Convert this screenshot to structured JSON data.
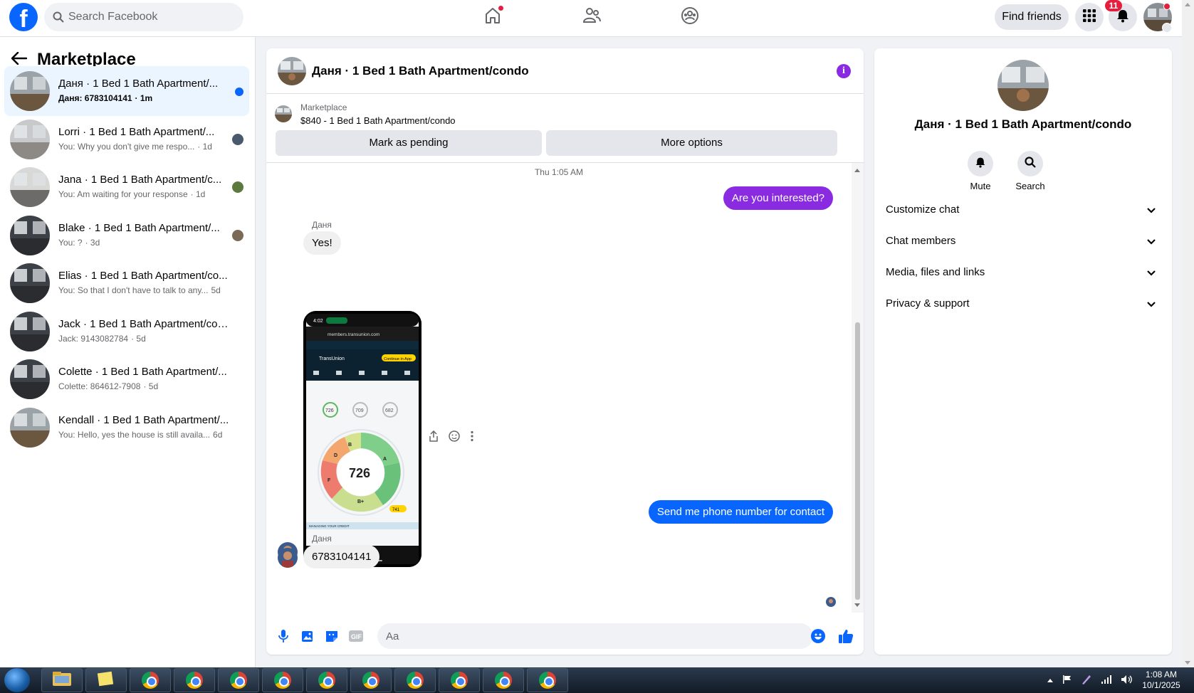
{
  "topbar": {
    "logo": "f",
    "search_placeholder": "Search Facebook",
    "find_friends": "Find friends",
    "notifications_count": "11"
  },
  "marketplace": {
    "title": "Marketplace",
    "conversations": [
      {
        "name": "Даня · 1 Bed 1 Bath Apartment/...",
        "snippet": "Даня: 6783104141",
        "time": "· 1m",
        "active": true,
        "unread": true
      },
      {
        "name": "Lorri · 1 Bed 1 Bath Apartment/...",
        "snippet": "You: Why you don't give me respo...",
        "time": "· 1d"
      },
      {
        "name": "Jana · 1 Bed 1 Bath Apartment/c...",
        "snippet": "You: Am waiting for your response",
        "time": "· 1d"
      },
      {
        "name": "Blake · 1 Bed 1 Bath Apartment/...",
        "snippet": "You: ?",
        "time": "· 3d"
      },
      {
        "name": "Elias · 1 Bed 1 Bath Apartment/co...",
        "snippet": "You: So that I don't have to talk to any...",
        "time": "5d"
      },
      {
        "name": "Jack · 1 Bed 1 Bath Apartment/con...",
        "snippet": "Jack: 9143082784",
        "time": "· 5d"
      },
      {
        "name": "Colette · 1 Bed 1 Bath Apartment/...",
        "snippet": "Colette: 864612-7908",
        "time": "· 5d"
      },
      {
        "name": "Kendall · 1 Bed 1 Bath Apartment/...",
        "snippet": "You: Hello, yes the house is still availa...",
        "time": "6d"
      }
    ]
  },
  "chat": {
    "title": "Даня · 1 Bed 1 Bath Apartment/condo",
    "listing_label": "Marketplace",
    "listing_price": "$840 - 1 Bed 1 Bath Apartment/condo",
    "mark_pending": "Mark as pending",
    "more_options": "More options",
    "timestamp": "Thu 1:05 AM",
    "messages": {
      "out1": "Are you interested?",
      "sender1": "Даня",
      "in1": "Yes!",
      "out2": "Send me phone number for contact",
      "sender2": "Даня",
      "in2": "6783104141"
    },
    "screenshot": {
      "time": "4:02",
      "url": "members.transunion.com",
      "brand": "TransUnion",
      "cta": "Continue in App",
      "score_main": "726",
      "scores": [
        "726",
        "709",
        "682"
      ],
      "grades": [
        "A",
        "B",
        "B+",
        "D",
        "F"
      ],
      "potential": "741",
      "manage": "MANAGING YOUR CREDIT"
    },
    "composer_placeholder": "Aa"
  },
  "details": {
    "title": "Даня · 1 Bed 1 Bath Apartment/condo",
    "mute": "Mute",
    "search": "Search",
    "sections": [
      "Customize chat",
      "Chat members",
      "Media, files and links",
      "Privacy & support"
    ]
  },
  "taskbar": {
    "time": "1:08 AM",
    "date": "10/1/2025"
  },
  "colors": {
    "facebook_blue": "#0866ff",
    "outgoing_bubble": "#8a2be2",
    "notification_red": "#e41e3f"
  }
}
